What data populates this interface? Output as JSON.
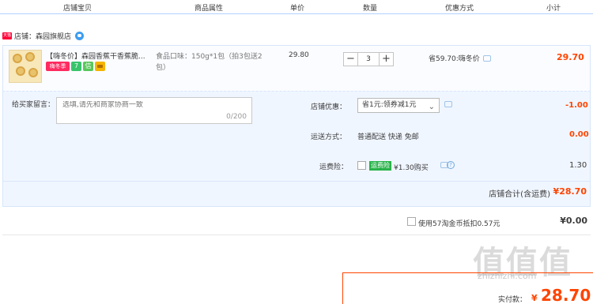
{
  "header": {
    "col_shop_item": "店铺宝贝",
    "col_attr": "商品属性",
    "col_price": "单价",
    "col_qty": "数量",
    "col_discount": "优惠方式",
    "col_subtotal": "小计"
  },
  "shop": {
    "badge": "天猫",
    "name": "店铺：森园旗舰店",
    "chat_icon": "wangwang-icon"
  },
  "item": {
    "title": "【嗨冬价】森园香蕉干香蕉脆...",
    "badge_main": "嗨冬季",
    "badge_7": "7",
    "badge_green": "信",
    "attr": "食品口味：150g*1包（拍3包送2包）",
    "price": "29.80",
    "qty": "3",
    "qty_minus": "−",
    "qty_plus": "+",
    "discount": "省59.70:嗨冬价",
    "total": "29.70"
  },
  "options": {
    "message_label": "给买家留言：",
    "message_placeholder": "选填,请先和商家协商一致",
    "message_count": "0/200",
    "shop_discount_label": "店铺优惠：",
    "shop_discount_value": "省1元:领券减1元",
    "shop_discount_amount": "-1.00",
    "shipping_label": "运送方式：",
    "shipping_value": "普通配送 快递 免邮",
    "shipping_amount": "0.00",
    "insurance_label": "运费险：",
    "insurance_badge": "运费险",
    "insurance_value": "¥1.30购买",
    "insurance_amount": "1.30"
  },
  "subtotal": {
    "label": "店铺合计(含运费)",
    "value": "¥28.70"
  },
  "coin": {
    "label": "使用57淘金币抵扣0.57元",
    "value": "¥0.00"
  },
  "payment": {
    "label": "实付款：",
    "currency": "¥",
    "amount": "28.70"
  },
  "watermark": {
    "big": "值值值",
    "small": "zhizhizhi.com"
  },
  "colors": {
    "accent": "#ff4400",
    "border": "#b2d1ff",
    "panel": "#f0f6ff"
  }
}
